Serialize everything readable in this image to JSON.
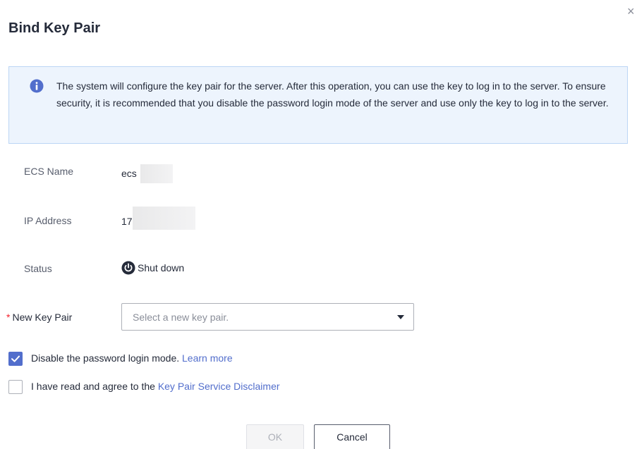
{
  "dialog": {
    "title": "Bind Key Pair",
    "close_glyph": "×"
  },
  "info": {
    "icon": "info-icon",
    "text": "The system will configure the key pair for the server. After this operation, you can use the key to log in to the server. To ensure security, it is recommended that you disable the password login mode of the server and use only the key to log in to the server."
  },
  "fields": {
    "ecs_name": {
      "label": "ECS Name",
      "value": "ecs"
    },
    "ip_address": {
      "label": "IP Address",
      "value": "17"
    },
    "status": {
      "label": "Status",
      "value": "Shut down",
      "icon": "power-icon"
    }
  },
  "new_key_pair": {
    "required_mark": "*",
    "label": "New Key Pair",
    "placeholder": "Select a new key pair."
  },
  "options": {
    "disable_password": {
      "checked": true,
      "label": "Disable the password login mode.",
      "link": "Learn more"
    },
    "agree": {
      "checked": false,
      "label": "I have read and agree to the",
      "link": "Key Pair Service Disclaimer"
    }
  },
  "buttons": {
    "ok": "OK",
    "cancel": "Cancel"
  },
  "colors": {
    "accent": "#526ecc",
    "info_bg": "#edf4fd",
    "info_border": "#bcd6f5",
    "required": "#f5222d"
  }
}
